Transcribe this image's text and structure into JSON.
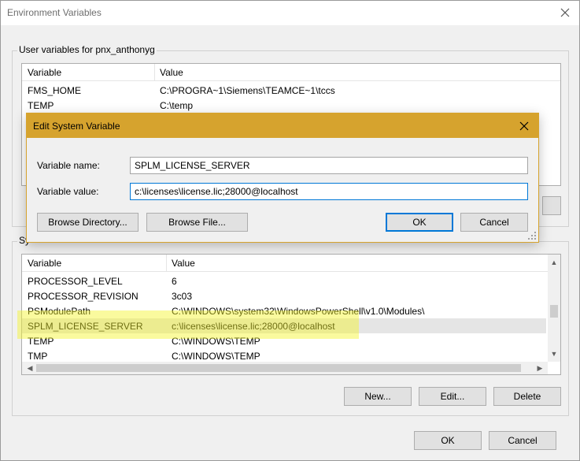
{
  "outer_window": {
    "title": "Environment Variables",
    "close_icon": "close-icon"
  },
  "user_vars": {
    "group_label": "User variables for pnx_anthonyg",
    "columns": [
      "Variable",
      "Value"
    ],
    "rows": [
      {
        "variable": "FMS_HOME",
        "value": "C:\\PROGRA~1\\Siemens\\TEAMCE~1\\tccs"
      },
      {
        "variable": "TEMP",
        "value": "C:\\temp"
      }
    ]
  },
  "system_vars": {
    "group_label": "Sy",
    "columns": [
      "Variable",
      "Value"
    ],
    "rows": [
      {
        "variable": "PROCESSOR_LEVEL",
        "value": "6"
      },
      {
        "variable": "PROCESSOR_REVISION",
        "value": "3c03"
      },
      {
        "variable": "PSModulePath",
        "value": "C:\\WINDOWS\\system32\\WindowsPowerShell\\v1.0\\Modules\\"
      },
      {
        "variable": "SPLM_LICENSE_SERVER",
        "value": "c:\\licenses\\license.lic;28000@localhost",
        "selected": true
      },
      {
        "variable": "TEMP",
        "value": "C:\\WINDOWS\\TEMP"
      },
      {
        "variable": "TMP",
        "value": "C:\\WINDOWS\\TEMP"
      }
    ],
    "buttons": {
      "new": "New...",
      "edit": "Edit...",
      "delete": "Delete"
    }
  },
  "footer": {
    "ok": "OK",
    "cancel": "Cancel"
  },
  "edit_dialog": {
    "title": "Edit System Variable",
    "accent_color": "#d6a32e",
    "name_label": "Variable name:",
    "name_value": "SPLM_LICENSE_SERVER",
    "value_label": "Variable value:",
    "value_value": "c:\\licenses\\license.lic;28000@localhost",
    "browse_directory": "Browse Directory...",
    "browse_file": "Browse File...",
    "ok": "OK",
    "cancel": "Cancel"
  },
  "highlight_color": "#f5f528"
}
